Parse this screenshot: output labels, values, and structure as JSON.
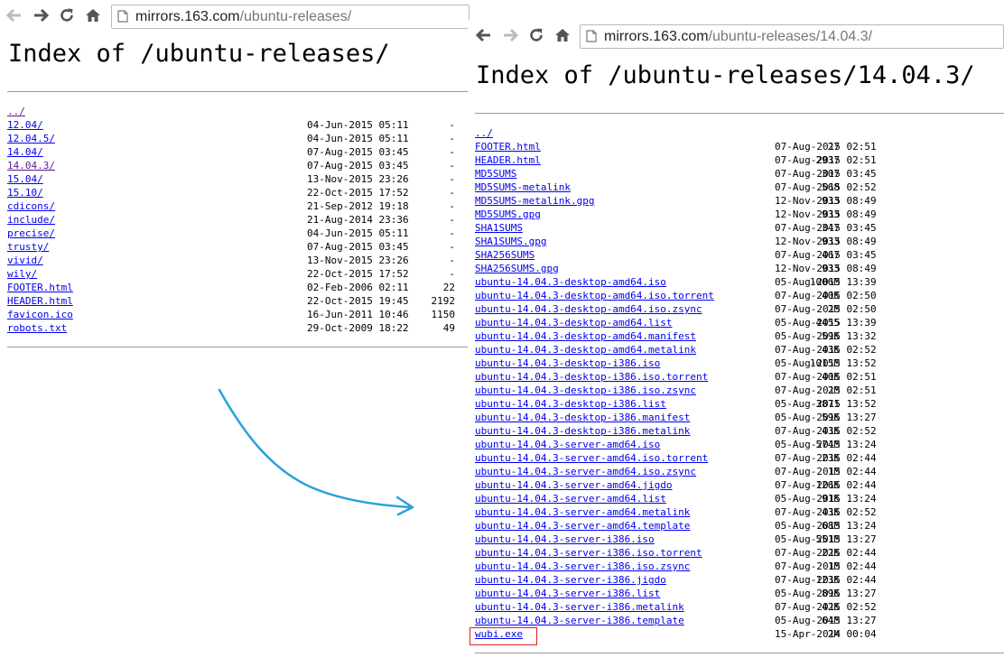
{
  "colors": {
    "link": "#0000ee",
    "visited": "#551a8b",
    "highlight": "#e02020",
    "arrow": "#2aa0dc"
  },
  "left": {
    "url_host": "mirrors.163.com",
    "url_path": "/ubuntu-releases/",
    "title": "Index of /ubuntu-releases/",
    "rows": [
      {
        "name": "../",
        "date": "",
        "size": "",
        "visited": true
      },
      {
        "name": "12.04/",
        "date": "04-Jun-2015 05:11",
        "size": "-",
        "visited": false
      },
      {
        "name": "12.04.5/",
        "date": "04-Jun-2015 05:11",
        "size": "-",
        "visited": false
      },
      {
        "name": "14.04/",
        "date": "07-Aug-2015 03:45",
        "size": "-",
        "visited": false
      },
      {
        "name": "14.04.3/",
        "date": "07-Aug-2015 03:45",
        "size": "-",
        "visited": true
      },
      {
        "name": "15.04/",
        "date": "13-Nov-2015 23:26",
        "size": "-",
        "visited": false
      },
      {
        "name": "15.10/",
        "date": "22-Oct-2015 17:52",
        "size": "-",
        "visited": false
      },
      {
        "name": "cdicons/",
        "date": "21-Sep-2012 19:18",
        "size": "-",
        "visited": false
      },
      {
        "name": "include/",
        "date": "21-Aug-2014 23:36",
        "size": "-",
        "visited": false
      },
      {
        "name": "precise/",
        "date": "04-Jun-2015 05:11",
        "size": "-",
        "visited": false
      },
      {
        "name": "trusty/",
        "date": "07-Aug-2015 03:45",
        "size": "-",
        "visited": false
      },
      {
        "name": "vivid/",
        "date": "13-Nov-2015 23:26",
        "size": "-",
        "visited": false
      },
      {
        "name": "wily/",
        "date": "22-Oct-2015 17:52",
        "size": "-",
        "visited": false
      },
      {
        "name": "FOOTER.html",
        "date": "02-Feb-2006 02:11",
        "size": "22",
        "visited": false
      },
      {
        "name": "HEADER.html",
        "date": "22-Oct-2015 19:45",
        "size": "2192",
        "visited": false
      },
      {
        "name": "favicon.ico",
        "date": "16-Jun-2011 10:46",
        "size": "1150",
        "visited": false
      },
      {
        "name": "robots.txt",
        "date": "29-Oct-2009 18:22",
        "size": "49",
        "visited": false
      }
    ]
  },
  "right": {
    "url_host": "mirrors.163.com",
    "url_path": "/ubuntu-releases/14.04.3/",
    "title": "Index of /ubuntu-releases/14.04.3/",
    "rows": [
      {
        "name": "../",
        "date": "",
        "size": ""
      },
      {
        "name": "FOOTER.html",
        "date": "07-Aug-2015 02:51",
        "size": "27"
      },
      {
        "name": "HEADER.html",
        "date": "07-Aug-2015 02:51",
        "size": "2937"
      },
      {
        "name": "MD5SUMS",
        "date": "07-Aug-2015 03:45",
        "size": "307"
      },
      {
        "name": "MD5SUMS-metalink",
        "date": "07-Aug-2015 02:52",
        "size": "568"
      },
      {
        "name": "MD5SUMS-metalink.gpg",
        "date": "12-Nov-2015 08:49",
        "size": "933"
      },
      {
        "name": "MD5SUMS.gpg",
        "date": "12-Nov-2015 08:49",
        "size": "933"
      },
      {
        "name": "SHA1SUMS",
        "date": "07-Aug-2015 03:45",
        "size": "347"
      },
      {
        "name": "SHA1SUMS.gpg",
        "date": "12-Nov-2015 08:49",
        "size": "933"
      },
      {
        "name": "SHA256SUMS",
        "date": "07-Aug-2015 03:45",
        "size": "467"
      },
      {
        "name": "SHA256SUMS.gpg",
        "date": "12-Nov-2015 08:49",
        "size": "933"
      },
      {
        "name": "ubuntu-14.04.3-desktop-amd64.iso",
        "date": "05-Aug-2015 13:39",
        "size": "1006M"
      },
      {
        "name": "ubuntu-14.04.3-desktop-amd64.iso.torrent",
        "date": "07-Aug-2015 02:50",
        "size": "40K"
      },
      {
        "name": "ubuntu-14.04.3-desktop-amd64.iso.zsync",
        "date": "07-Aug-2015 02:50",
        "size": "2M"
      },
      {
        "name": "ubuntu-14.04.3-desktop-amd64.list",
        "date": "05-Aug-2015 13:39",
        "size": "4455"
      },
      {
        "name": "ubuntu-14.04.3-desktop-amd64.manifest",
        "date": "05-Aug-2015 13:32",
        "size": "59K"
      },
      {
        "name": "ubuntu-14.04.3-desktop-amd64.metalink",
        "date": "07-Aug-2015 02:52",
        "size": "43K"
      },
      {
        "name": "ubuntu-14.04.3-desktop-i386.iso",
        "date": "05-Aug-2015 13:52",
        "size": "1015M"
      },
      {
        "name": "ubuntu-14.04.3-desktop-i386.iso.torrent",
        "date": "07-Aug-2015 02:51",
        "size": "40K"
      },
      {
        "name": "ubuntu-14.04.3-desktop-i386.iso.zsync",
        "date": "07-Aug-2015 02:51",
        "size": "2M"
      },
      {
        "name": "ubuntu-14.04.3-desktop-i386.list",
        "date": "05-Aug-2015 13:52",
        "size": "3871"
      },
      {
        "name": "ubuntu-14.04.3-desktop-i386.manifest",
        "date": "05-Aug-2015 13:27",
        "size": "59K"
      },
      {
        "name": "ubuntu-14.04.3-desktop-i386.metalink",
        "date": "07-Aug-2015 02:52",
        "size": "43K"
      },
      {
        "name": "ubuntu-14.04.3-server-amd64.iso",
        "date": "05-Aug-2015 13:24",
        "size": "574M"
      },
      {
        "name": "ubuntu-14.04.3-server-amd64.iso.torrent",
        "date": "07-Aug-2015 02:44",
        "size": "23K"
      },
      {
        "name": "ubuntu-14.04.3-server-amd64.iso.zsync",
        "date": "07-Aug-2015 02:44",
        "size": "1M"
      },
      {
        "name": "ubuntu-14.04.3-server-amd64.jigdo",
        "date": "07-Aug-2015 02:44",
        "size": "126K"
      },
      {
        "name": "ubuntu-14.04.3-server-amd64.list",
        "date": "05-Aug-2015 13:24",
        "size": "91K"
      },
      {
        "name": "ubuntu-14.04.3-server-amd64.metalink",
        "date": "07-Aug-2015 02:52",
        "size": "43K"
      },
      {
        "name": "ubuntu-14.04.3-server-amd64.template",
        "date": "05-Aug-2015 13:24",
        "size": "68M"
      },
      {
        "name": "ubuntu-14.04.3-server-i386.iso",
        "date": "05-Aug-2015 13:27",
        "size": "551M"
      },
      {
        "name": "ubuntu-14.04.3-server-i386.iso.torrent",
        "date": "07-Aug-2015 02:44",
        "size": "22K"
      },
      {
        "name": "ubuntu-14.04.3-server-i386.iso.zsync",
        "date": "07-Aug-2015 02:44",
        "size": "1M"
      },
      {
        "name": "ubuntu-14.04.3-server-i386.jigdo",
        "date": "07-Aug-2015 02:44",
        "size": "123K"
      },
      {
        "name": "ubuntu-14.04.3-server-i386.list",
        "date": "05-Aug-2015 13:27",
        "size": "89K"
      },
      {
        "name": "ubuntu-14.04.3-server-i386.metalink",
        "date": "07-Aug-2015 02:52",
        "size": "42K"
      },
      {
        "name": "ubuntu-14.04.3-server-i386.template",
        "date": "05-Aug-2015 13:27",
        "size": "64M"
      },
      {
        "name": "wubi.exe",
        "date": "15-Apr-2014 00:04",
        "size": "2M"
      }
    ]
  },
  "icons": {
    "back": "arrow-left-icon",
    "forward": "arrow-right-icon",
    "reload": "reload-icon",
    "home": "home-icon",
    "page": "page-icon"
  }
}
